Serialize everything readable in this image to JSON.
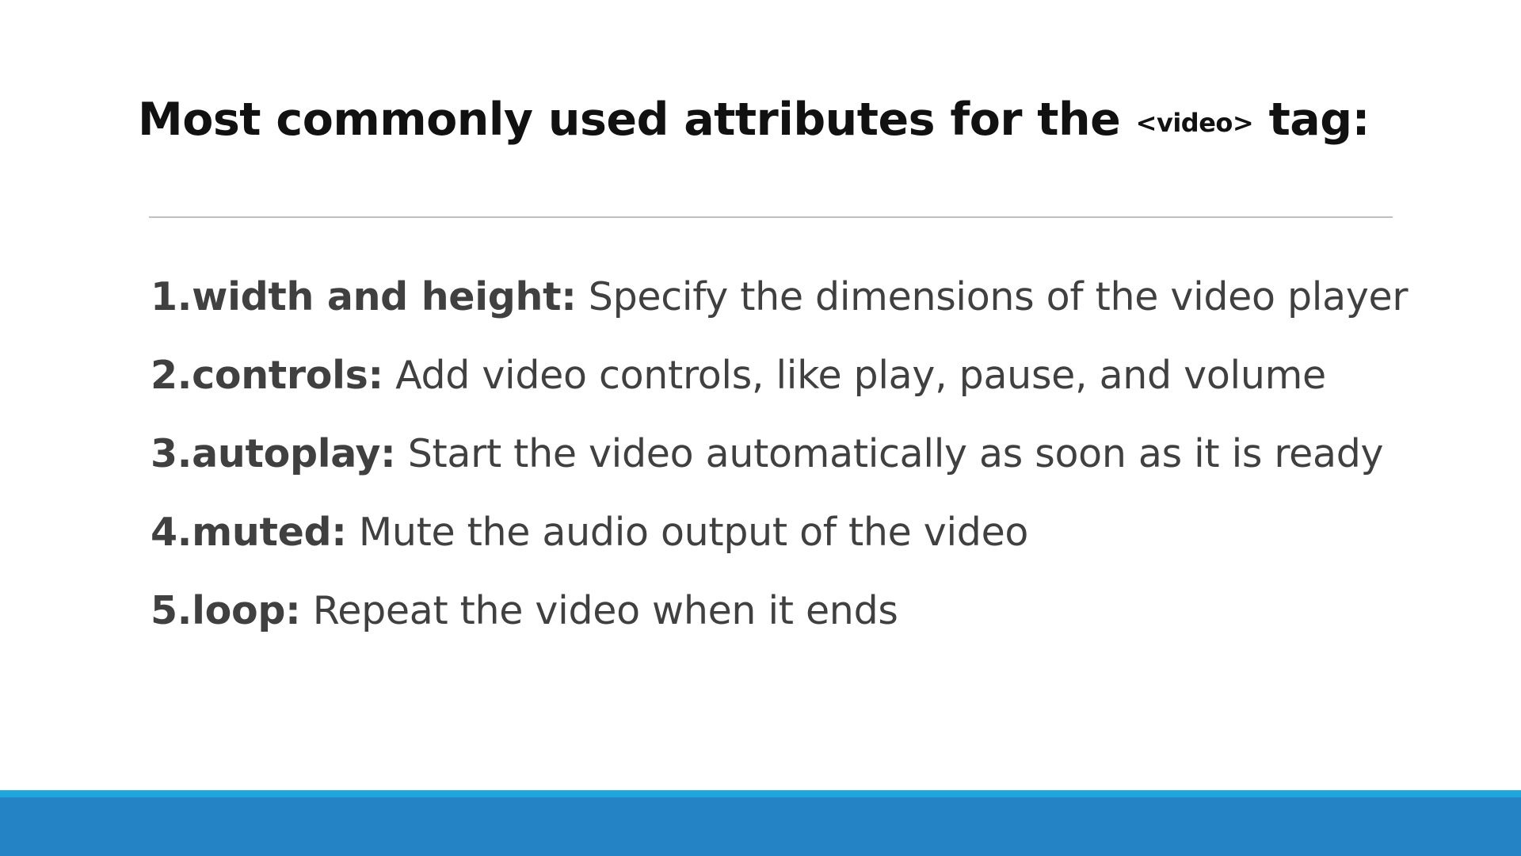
{
  "title": {
    "prefix": "Most commonly used attributes for the",
    "code": "<video>",
    "suffix": "tag:"
  },
  "attributes": [
    {
      "number": "1.",
      "name": "width and height:",
      "description": "Specify the dimensions of the video player"
    },
    {
      "number": "2.",
      "name": "controls:",
      "description": "Add video controls, like play, pause, and volume"
    },
    {
      "number": "3.",
      "name": "autoplay:",
      "description": "Start the video automatically as soon as it is ready"
    },
    {
      "number": "4.",
      "name": "muted:",
      "description": "Mute the audio output of the video"
    },
    {
      "number": "5.",
      "name": "loop:",
      "description": "Repeat the video when it ends"
    }
  ],
  "colors": {
    "footer_bar": "#2483c5",
    "footer_accent": "#1fa6dd",
    "title_text": "#111111",
    "body_text": "#404040"
  }
}
